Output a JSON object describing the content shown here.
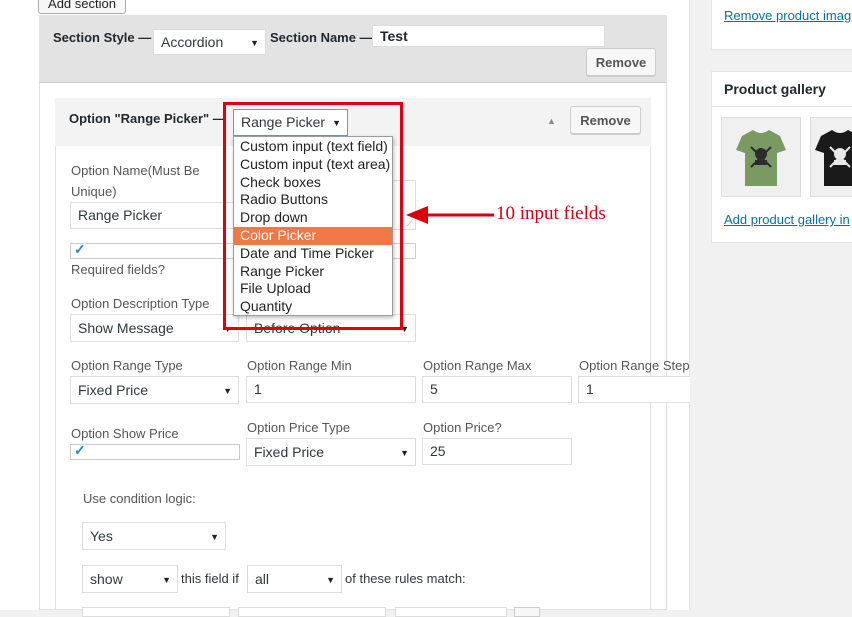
{
  "toolbar": {
    "add_section_label": "Add section"
  },
  "section": {
    "style_label": "Section Style —",
    "style_value": "Accordion",
    "name_label": "Section Name —",
    "name_value": "Test",
    "remove_label": "Remove"
  },
  "option": {
    "title": "Option \"Range Picker\" —",
    "type_value": "Range Picker",
    "remove_label": "Remove",
    "name_label_line1": "Option Name(Must Be",
    "name_label_line2": "Unique)",
    "name_value": "Range Picker",
    "required_label": "Required fields?",
    "desc_type_label": "Option Description Type",
    "desc_type_value": "Show Message",
    "desc_position_value": "Before Option",
    "range_type_label": "Option Range Type",
    "range_type_value": "Fixed Price",
    "range_min_label": "Option Range Min",
    "range_min_value": "1",
    "range_max_label": "Option Range Max",
    "range_max_value": "5",
    "range_step_label": "Option Range Step",
    "range_step_value": "1",
    "show_price_label": "Option Show Price",
    "price_type_label": "Option Price Type",
    "price_type_value": "Fixed Price",
    "price_label": "Option Price?",
    "price_value": "25",
    "condition_label": "Use condition logic:",
    "condition_value": "Yes",
    "show_value": "show",
    "this_field_if": "this field if",
    "match_value": "all",
    "rules_match": "of these rules match:"
  },
  "dropdown": {
    "items": [
      "Custom input (text field)",
      "Custom input (text area)",
      "Check boxes",
      "Radio Buttons",
      "Drop down",
      "Color Picker",
      "Date and Time Picker",
      "Range Picker",
      "File Upload",
      "Quantity"
    ],
    "highlighted_index": 5,
    "highlight_color": "#f07746"
  },
  "annotation": {
    "text": "10 input fields",
    "color": "#d9000d"
  },
  "sidebar": {
    "remove_image_link": "Remove product imag",
    "gallery_title": "Product gallery",
    "add_gallery_link": "Add product gallery in"
  },
  "icons": {
    "caret": "triangle-down",
    "arrow": "left-arrow",
    "collapse": "triangle-up",
    "checkmark": "check"
  }
}
